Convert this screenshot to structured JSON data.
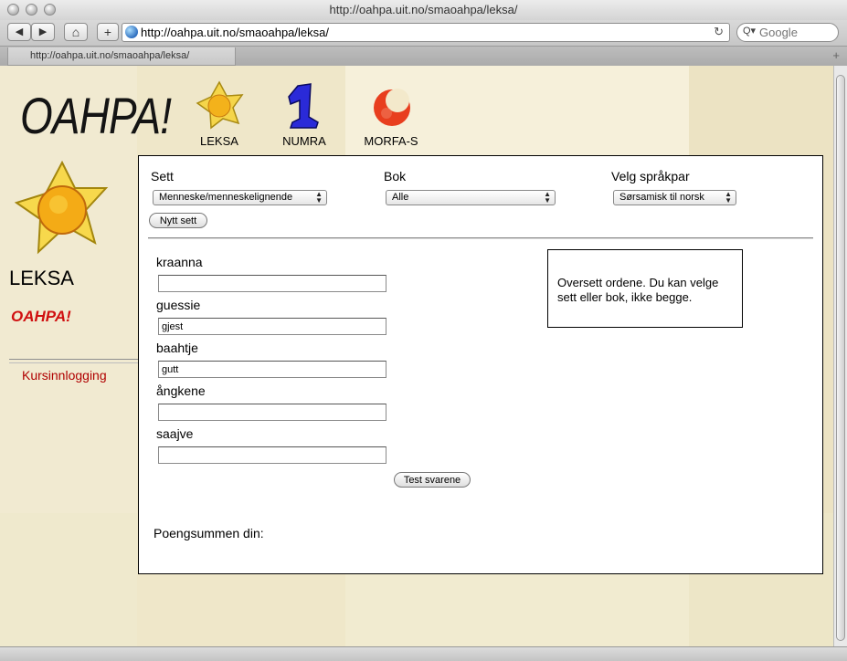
{
  "browser": {
    "window_title": "http://oahpa.uit.no/smaoahpa/leksa/",
    "url": "http://oahpa.uit.no/smaoahpa/leksa/",
    "search_placeholder": "Google",
    "tab_label": "http://oahpa.uit.no/smaoahpa/leksa/",
    "tab_plus": "+",
    "back": "◀",
    "forward": "▶",
    "home": "⌂",
    "add": "+",
    "reload": "↻",
    "search_glyph": "Q▾"
  },
  "header": {
    "logo": "OAHPA!",
    "nav": [
      {
        "label": "LEKSA",
        "icon": "sun-star-icon"
      },
      {
        "label": "NUMRA",
        "icon": "blue-one-icon"
      },
      {
        "label": "MORFA-S",
        "icon": "red-moon-icon"
      }
    ]
  },
  "sidebar": {
    "title": "LEKSA",
    "subtitle": "OAHPA!",
    "link": "Kursinnlogging"
  },
  "form": {
    "sett_label": "Sett",
    "sett_value": "Menneske/menneskelignende",
    "bok_label": "Bok",
    "bok_value": "Alle",
    "sprak_label": "Velg språkpar",
    "sprak_value": "Sørsamisk til norsk",
    "new_set_button": "Nytt sett",
    "words": [
      {
        "word": "kraanna",
        "answer": ""
      },
      {
        "word": "guessie",
        "answer": "gjest"
      },
      {
        "word": "baahtje",
        "answer": "gutt"
      },
      {
        "word": "ångkene",
        "answer": ""
      },
      {
        "word": "saajve",
        "answer": ""
      }
    ],
    "test_button": "Test svarene",
    "info": "Oversett ordene. Du kan velge sett eller bok, ikke begge.",
    "score_label": "Poengsummen din:"
  },
  "colors": {
    "page_bg": "#efe7c9",
    "link_red": "#b00000",
    "subtitle_red": "#d01010"
  }
}
